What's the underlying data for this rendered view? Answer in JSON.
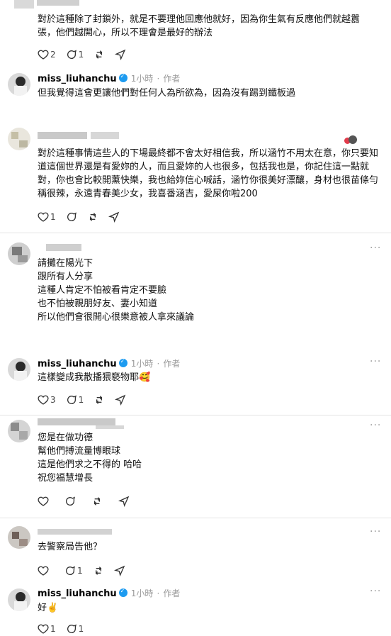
{
  "threads": [
    {
      "id": "c1",
      "text": "對於這種除了封鎖外，就是不要理他回應他就好，因為你生氣有反應他們就越囂張，他們越開心，所以不理會是最好的辦法",
      "likes": "2",
      "replies": "1"
    },
    {
      "id": "r1",
      "author": "miss_liuhanchu",
      "time": "1小時",
      "role": "作者",
      "text": "但我覺得這會更讓他們對任何人為所欲為，因為沒有踢到鐵板過"
    },
    {
      "id": "c2",
      "text": "對於這種事情這些人的下場最終都不會太好相信我，所以涵竹不用太在意，你只要知道這個世界還是有愛妳的人，而且愛妳的人也很多，包括我也是，你記住這一點就對，你也會比較開薰快樂，我也給妳信心喊話，涵竹你很美好漂釀，身材也很苗條勻稱很辣，永遠青春美少女，我喜番涵吉，愛屎你啦200",
      "likes": "1"
    },
    {
      "id": "c3",
      "text": "請攤在陽光下\n跟所有人分享\n這種人肯定不怕被看肯定不要臉\n也不怕被親朋好友、妻小知道\n所以他們會很開心很樂意被人拿來議論"
    },
    {
      "id": "r2",
      "author": "miss_liuhanchu",
      "time": "1小時",
      "role": "作者",
      "text": "這樣變成我散播猥褻物耶🥰",
      "likes": "3",
      "replies": "1"
    },
    {
      "id": "c4",
      "text": "您是在做功德\n幫他們搏流量博眼球\n這是他們求之不得的 哈哈\n祝您福慧增長"
    },
    {
      "id": "c5",
      "text": "去警察局告他？",
      "replies": "1"
    },
    {
      "id": "r3",
      "author": "miss_liuhanchu",
      "time": "1小時",
      "role": "作者",
      "text": "好✌️",
      "likes": "1",
      "replies": "1"
    }
  ],
  "colors": {
    "verified": "#1d9bf0",
    "muted": "#9a9a9a",
    "divider": "#e4e4e4"
  },
  "icons": [
    "heart-icon",
    "comment-icon",
    "repost-icon",
    "share-icon",
    "more-icon",
    "verified-icon"
  ]
}
